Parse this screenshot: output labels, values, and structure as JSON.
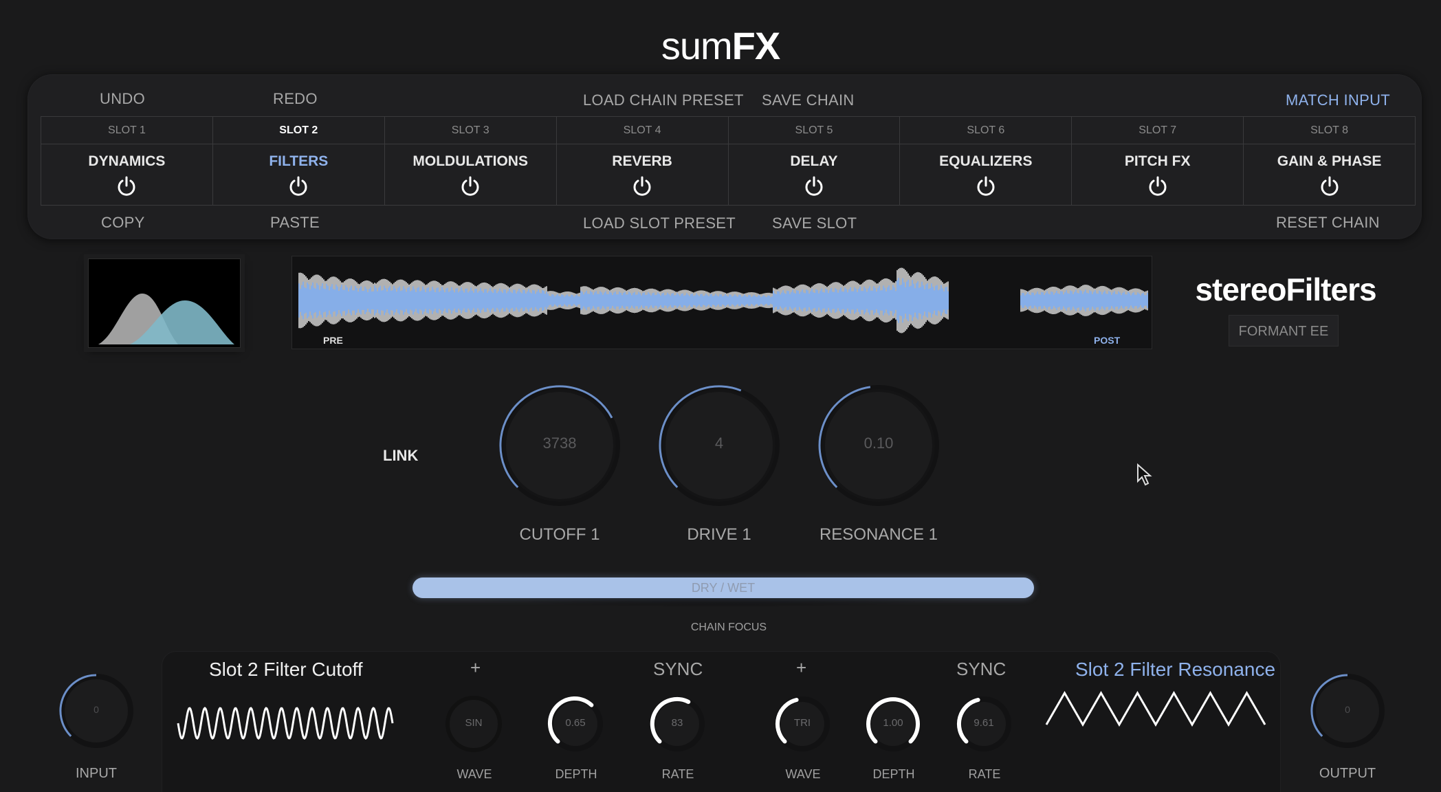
{
  "app": {
    "logo_prefix": "sum",
    "logo_suffix": "FX"
  },
  "toolbar": {
    "undo": "UNDO",
    "redo": "REDO",
    "load_chain_preset": "LOAD CHAIN PRESET",
    "save_chain": "SAVE CHAIN",
    "match_input": "MATCH INPUT",
    "copy": "COPY",
    "paste": "PASTE",
    "load_slot_preset": "LOAD SLOT PRESET",
    "save_slot": "SAVE SLOT",
    "reset_chain": "RESET CHAIN"
  },
  "slots": [
    {
      "label": "SLOT 1",
      "name": "DYNAMICS",
      "active": false
    },
    {
      "label": "SLOT 2",
      "name": "FILTERS",
      "active": true
    },
    {
      "label": "SLOT 3",
      "name": "MOLDULATIONS",
      "active": false
    },
    {
      "label": "SLOT 4",
      "name": "REVERB",
      "active": false
    },
    {
      "label": "SLOT 5",
      "name": "DELAY",
      "active": false
    },
    {
      "label": "SLOT 6",
      "name": "EQUALIZERS",
      "active": false
    },
    {
      "label": "SLOT 7",
      "name": "PITCH FX",
      "active": false
    },
    {
      "label": "SLOT 8",
      "name": "GAIN & PHASE",
      "active": false
    }
  ],
  "waveform": {
    "pre_label": "PRE",
    "post_label": "POST"
  },
  "module": {
    "title": "stereoFilters",
    "preset": "FORMANT EE",
    "link_label": "LINK",
    "knobs": [
      {
        "caption": "CUTOFF 1",
        "value": "3738",
        "level": 0.73
      },
      {
        "caption": "DRIVE 1",
        "value": "4",
        "level": 0.58
      },
      {
        "caption": "RESONANCE 1",
        "value": "0.10",
        "level": 0.47
      }
    ]
  },
  "dry_wet": {
    "label": "DRY / WET",
    "level": 1.0
  },
  "chain_focus": "CHAIN FOCUS",
  "modulators": {
    "left": {
      "title": "Slot 2 Filter Cutoff",
      "plus": "+",
      "sync": "SYNC",
      "wave": {
        "value": "SIN",
        "caption": "WAVE"
      },
      "depth": {
        "value": "0.65",
        "caption": "DEPTH",
        "level": 0.65
      },
      "rate": {
        "value": "83",
        "caption": "RATE",
        "level": 0.6
      }
    },
    "right": {
      "title": "Slot 2 Filter Resonance",
      "plus": "+",
      "sync": "SYNC",
      "wave": {
        "value": "TRI",
        "caption": "WAVE"
      },
      "depth": {
        "value": "1.00",
        "caption": "DEPTH",
        "level": 1.0
      },
      "rate": {
        "value": "9.61",
        "caption": "RATE",
        "level": 0.45
      }
    }
  },
  "io": {
    "input": {
      "caption": "INPUT",
      "value": "0",
      "level": 0.5
    },
    "output": {
      "caption": "OUTPUT",
      "value": "0",
      "level": 0.5
    }
  },
  "colors": {
    "accent": "#8fb2ec",
    "knob_ring": "#6c8fc8",
    "mod_ring": "#ffffff",
    "background": "#1a1a1b"
  }
}
